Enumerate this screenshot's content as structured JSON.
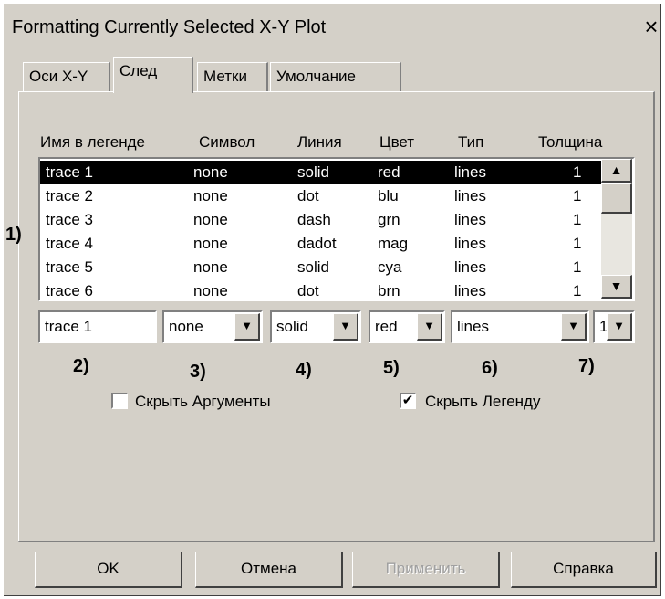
{
  "window": {
    "title": "Formatting Currently Selected X-Y Plot",
    "close_label": "×"
  },
  "tabs": [
    {
      "label": "Оси X-Y"
    },
    {
      "label": "След"
    },
    {
      "label": "Метки"
    },
    {
      "label": "Умолчание"
    }
  ],
  "active_tab": "След",
  "columns": [
    "Имя в легенде",
    "Символ",
    "Линия",
    "Цвет",
    "Тип",
    "Толщина"
  ],
  "traces": [
    {
      "name": "trace 1",
      "symbol": "none",
      "line": "solid",
      "color": "red",
      "type": "lines",
      "weight": "1",
      "selected": true
    },
    {
      "name": "trace 2",
      "symbol": "none",
      "line": "dot",
      "color": "blu",
      "type": "lines",
      "weight": "1"
    },
    {
      "name": "trace 3",
      "symbol": "none",
      "line": "dash",
      "color": "grn",
      "type": "lines",
      "weight": "1"
    },
    {
      "name": "trace 4",
      "symbol": "none",
      "line": "dadot",
      "color": "mag",
      "type": "lines",
      "weight": "1"
    },
    {
      "name": "trace 5",
      "symbol": "none",
      "line": "solid",
      "color": "cya",
      "type": "lines",
      "weight": "1"
    },
    {
      "name": "trace 6",
      "symbol": "none",
      "line": "dot",
      "color": "brn",
      "type": "lines",
      "weight": "1"
    }
  ],
  "editors": {
    "name_value": "trace 1",
    "symbol_value": "none",
    "line_value": "solid",
    "color_value": "red",
    "type_value": "lines",
    "weight_value": "1"
  },
  "markers": [
    "1)",
    "2)",
    "3)",
    "4)",
    "5)",
    "6)",
    "7)"
  ],
  "checkboxes": {
    "hide_args": {
      "label": "Скрыть Аргументы",
      "checked": false
    },
    "hide_legend": {
      "label": "Скрыть Легенду",
      "checked": true
    }
  },
  "buttons": {
    "ok": "OK",
    "cancel": "Отмена",
    "apply": "Применить",
    "help": "Справка"
  },
  "icons": {
    "up": "▲",
    "down": "▼",
    "check": "✔"
  }
}
